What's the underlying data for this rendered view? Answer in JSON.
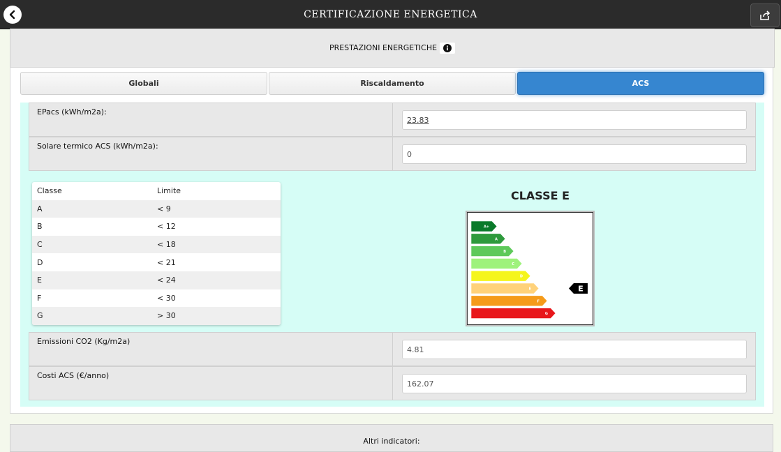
{
  "header": {
    "title": "CERTIFICAZIONE ENERGETICA",
    "back_icon": "chevron-left-icon",
    "share_icon": "share-icon"
  },
  "section": {
    "title": "PRESTAZIONI ENERGETICHE",
    "info_icon": "info-icon"
  },
  "tabs": [
    {
      "label": "Globali",
      "active": false
    },
    {
      "label": "Riscaldamento",
      "active": false
    },
    {
      "label": "ACS",
      "active": true
    }
  ],
  "fields": {
    "epacs": {
      "label": "EPacs (kWh/m2a):",
      "value": "23.83"
    },
    "solare": {
      "label": "Solare termico ACS (kWh/m2a):",
      "value": "0"
    },
    "emissioni": {
      "label": "Emissioni CO2 (Kg/m2a)",
      "value": "4.81"
    },
    "costi": {
      "label": "Costi ACS (€/anno)",
      "value": "162.07"
    }
  },
  "class_table": {
    "headers": [
      "Classe",
      "Limite"
    ],
    "rows": [
      [
        "A",
        "< 9"
      ],
      [
        "B",
        "< 12"
      ],
      [
        "C",
        "< 18"
      ],
      [
        "D",
        "< 21"
      ],
      [
        "E",
        "< 24"
      ],
      [
        "F",
        "< 30"
      ],
      [
        "G",
        "> 30"
      ]
    ]
  },
  "energy_class": {
    "title": "CLASSE E",
    "current": "E",
    "bars": [
      {
        "label": "A+",
        "color": "#0a7a2a"
      },
      {
        "label": "A",
        "color": "#2e9a3c"
      },
      {
        "label": "B",
        "color": "#5ec95a"
      },
      {
        "label": "C",
        "color": "#9ef27c"
      },
      {
        "label": "D",
        "color": "#f5f51c"
      },
      {
        "label": "E",
        "color": "#ffd27a"
      },
      {
        "label": "F",
        "color": "#f59b1a"
      },
      {
        "label": "G",
        "color": "#e8171b"
      }
    ]
  },
  "footer_section": {
    "title": "Altri indicatori:"
  },
  "colors": {
    "accent": "#3686d0",
    "teal_bg": "#d6fdf6"
  }
}
